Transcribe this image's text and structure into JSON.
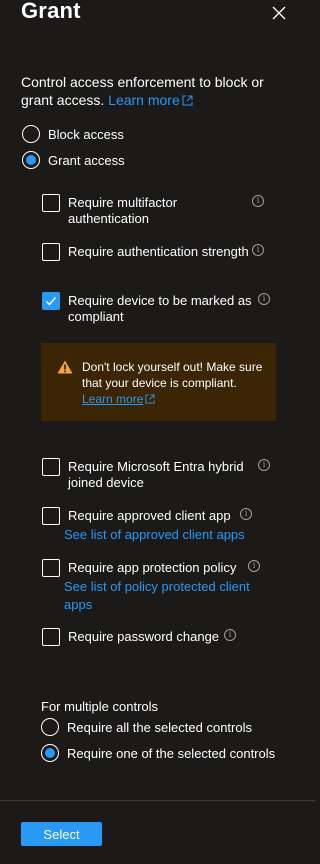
{
  "header": {
    "title": "Grant"
  },
  "description": {
    "text": "Control access enforcement to block or grant access.",
    "learn_more": "Learn more"
  },
  "access_options": [
    {
      "label": "Block access",
      "selected": false
    },
    {
      "label": "Grant access",
      "selected": true
    }
  ],
  "controls": [
    {
      "label": "Require multifactor authentication",
      "checked": false
    },
    {
      "label": "Require authentication strength",
      "checked": false
    },
    {
      "label": "Require device to be marked as compliant",
      "checked": true
    },
    {
      "label": "Require Microsoft Entra hybrid joined device",
      "checked": false
    },
    {
      "label": "Require approved client app",
      "checked": false,
      "link": "See list of approved client apps"
    },
    {
      "label": "Require app protection policy",
      "checked": false,
      "link": "See list of policy protected client apps"
    },
    {
      "label": "Require password change",
      "checked": false
    }
  ],
  "warning": {
    "text": "Don't lock yourself out! Make sure that your device is compliant.",
    "learn_more": "Learn more",
    "color": "#3b2504"
  },
  "multiple_controls": {
    "label": "For multiple controls",
    "options": [
      {
        "label": "Require all the selected controls",
        "selected": false
      },
      {
        "label": "Require one of the selected controls",
        "selected": true
      }
    ]
  },
  "footer": {
    "select_label": "Select"
  },
  "colors": {
    "background": "#1b1a19",
    "accent": "#2899f5"
  },
  "icons": {
    "close": "close-icon",
    "info": "info-icon",
    "warning": "warning-icon",
    "external": "external-link-icon"
  }
}
